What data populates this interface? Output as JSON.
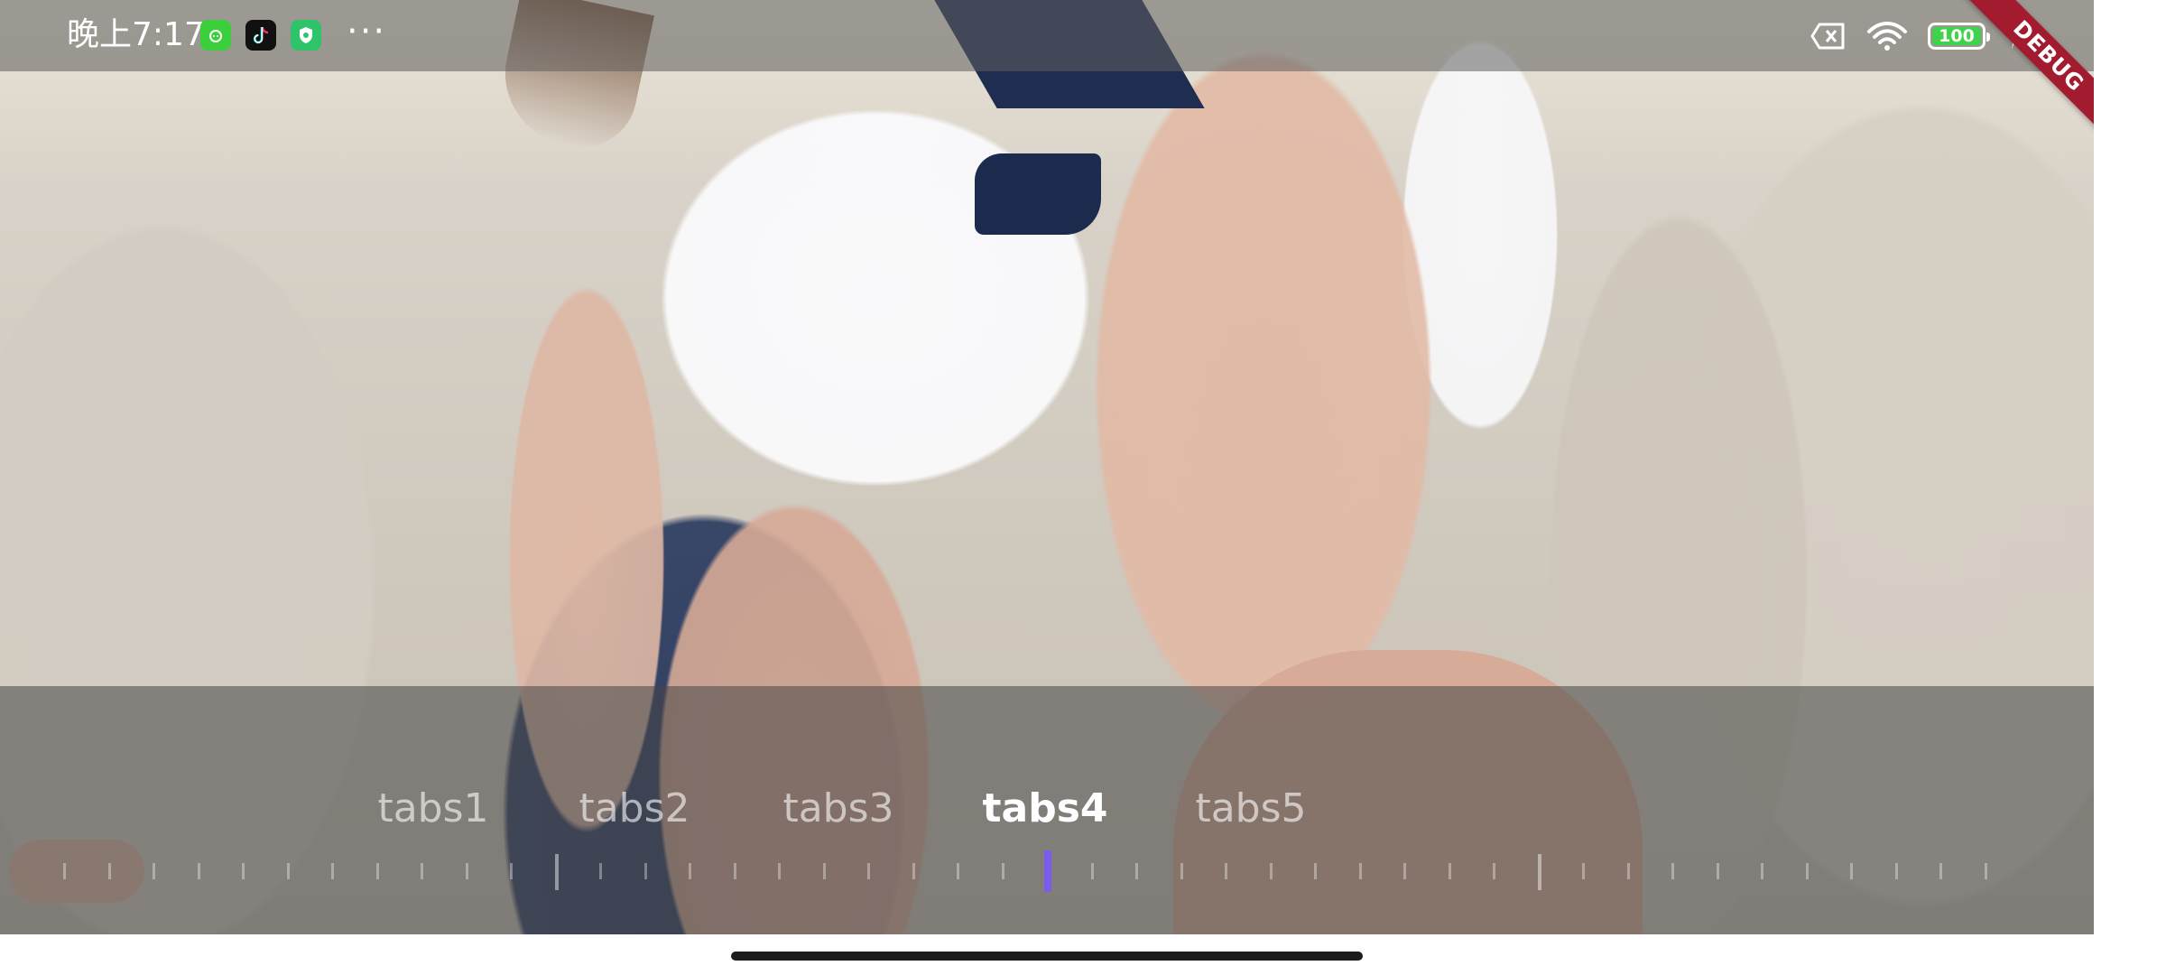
{
  "status_bar": {
    "time": "晚上7:17",
    "more": "···",
    "battery_level": "100",
    "icons": [
      "app-icon-green",
      "tiktok-icon",
      "security-icon",
      "no-sim-icon",
      "wifi-icon",
      "battery-icon",
      "charging-icon"
    ]
  },
  "debug_banner": "DEBUG",
  "tabs": [
    {
      "label": "tabs1",
      "active": false
    },
    {
      "label": "tabs2",
      "active": false
    },
    {
      "label": "tabs3",
      "active": false
    },
    {
      "label": "tabs4",
      "active": true
    },
    {
      "label": "tabs5",
      "active": false
    }
  ],
  "colors": {
    "indicator": "#7b5cf0",
    "debug_banner": "#a31b2f",
    "battery_fill": "#3fd24a"
  }
}
